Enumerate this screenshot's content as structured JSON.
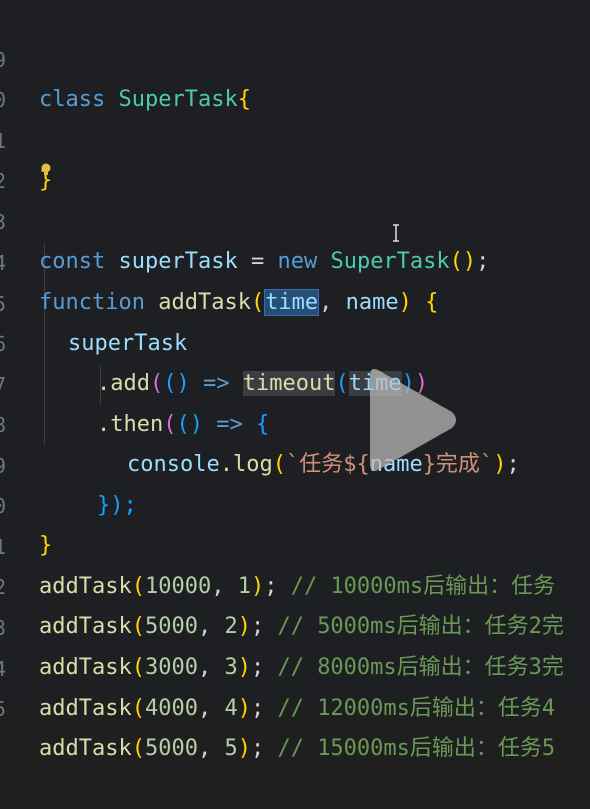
{
  "editor": {
    "lines": [
      {
        "num": "9",
        "id": "l9"
      },
      {
        "num": "0",
        "id": "l10"
      },
      {
        "num": "1",
        "id": "l11"
      },
      {
        "num": "2",
        "id": "l12"
      },
      {
        "num": "3",
        "id": "l13"
      },
      {
        "num": "4",
        "id": "l14"
      },
      {
        "num": "5",
        "id": "l15"
      },
      {
        "num": "6",
        "id": "l16"
      },
      {
        "num": "7",
        "id": "l17"
      },
      {
        "num": "8",
        "id": "l18"
      },
      {
        "num": "9",
        "id": "l19"
      },
      {
        "num": "0",
        "id": "l20"
      },
      {
        "num": "1",
        "id": "l21"
      },
      {
        "num": "2",
        "id": "l22"
      },
      {
        "num": "3",
        "id": "l23"
      },
      {
        "num": "4",
        "id": "l24"
      },
      {
        "num": "5",
        "id": "l25"
      }
    ],
    "tokens": {
      "class_kw": "class",
      "class_name": "SuperTask",
      "open_brace": "{",
      "close_brace": "}",
      "const_kw": "const",
      "super_task_var": "superTask",
      "equals": " = ",
      "new_kw": "new",
      "super_task_ctor": "SuperTask",
      "ctor_parens": "()",
      "semicolon": ";",
      "function_kw": "function",
      "add_task_fn": "addTask",
      "param_time": "time",
      "comma": ", ",
      "param_name": "name",
      "paren_open": "(",
      "paren_close": ")",
      "brace_open_sp": " {",
      "dot_add": ".add",
      "arrow_parens": "()",
      "arrow": " => ",
      "timeout_fn": "timeout",
      "dot_then": ".then",
      "console": "console",
      "dot_log": ".log",
      "template_start": "`任务${",
      "template_var": "name",
      "template_end": "}完成`",
      "close_then": "});",
      "call_fn": "addTask"
    },
    "calls": [
      {
        "arg1": "10000",
        "arg2": "1",
        "comment": "// 10000ms后输出：任务"
      },
      {
        "arg1": "5000",
        "arg2": "2",
        "comment": "// 5000ms后输出：任务2完"
      },
      {
        "arg1": "3000",
        "arg2": "3",
        "comment": "// 8000ms后输出：任务3完"
      },
      {
        "arg1": "4000",
        "arg2": "4",
        "comment": "// 12000ms后输出：任务4"
      },
      {
        "arg1": "5000",
        "arg2": "5",
        "comment": "// 15000ms后输出：任务5"
      }
    ]
  },
  "overlay": {
    "play_icon": "play-icon",
    "lightbulb_icon": "lightbulb-icon"
  },
  "colors": {
    "background": "#1e1f22",
    "keyword": "#569cd6",
    "class_name": "#4ec9b0",
    "function": "#dcdcaa",
    "variable": "#9cdcfe",
    "number": "#b5cea8",
    "comment": "#6a9955",
    "string": "#ce9178"
  }
}
